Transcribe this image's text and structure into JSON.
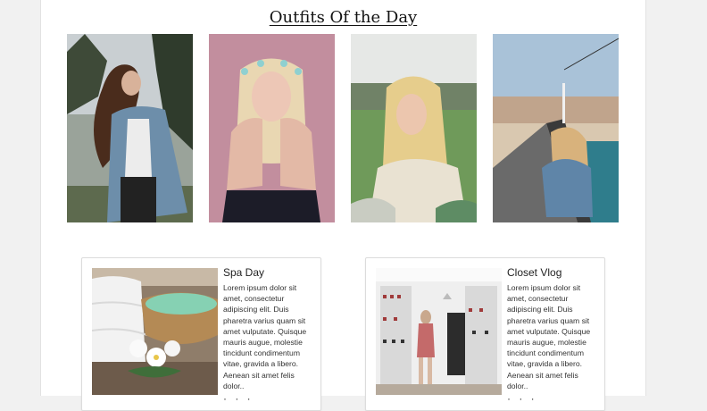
{
  "section": {
    "title": "Outfits Of the Day"
  },
  "gallery": [
    {
      "subject": "woman in denim jacket tossing long hair, trees behind"
    },
    {
      "subject": "blonde woman with hair clips, hands on face, pink wall"
    },
    {
      "subject": "blonde woman in white knit top, green field"
    },
    {
      "subject": "woman in denim jacket walking on pier by the sea"
    }
  ],
  "posts": [
    {
      "title": "Spa Day",
      "body": "Lorem ipsum dolor sit amet, consectetur adipiscing elit. Duis pharetra varius quam sit amet vulputate. Quisque mauris augue, molestie tincidunt condimentum vitae, gravida a libero. Aenean sit amet felis dolor..",
      "footer": "· · ·",
      "image": "white towels, bowl of green bath salt and white flowers"
    },
    {
      "title": "Closet Vlog",
      "body": "Lorem ipsum dolor sit amet, consectetur adipiscing elit. Duis pharetra varius quam sit amet vulputate. Quisque mauris augue, molestie tincidunt condimentum vitae, gravida a libero. Aenean sit amet felis dolor..",
      "footer": "· · ·",
      "image": "woman in a walk-in closet full of shoes and clothes"
    }
  ]
}
